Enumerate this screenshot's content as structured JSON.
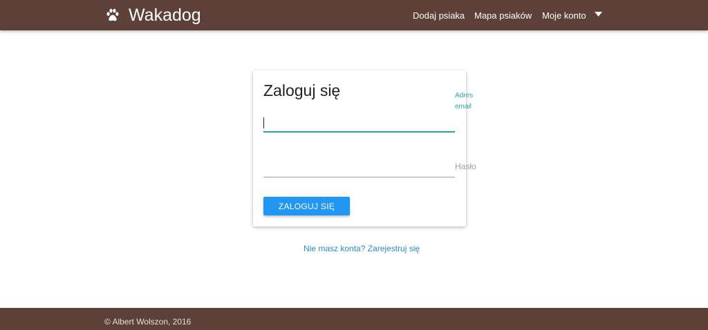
{
  "header": {
    "brand": "Wakadog",
    "brand_icon": "paw-icon",
    "nav": [
      {
        "label": "Dodaj psiaka"
      },
      {
        "label": "Mapa psiaków"
      },
      {
        "label": "Moje konto"
      }
    ],
    "dropdown_icon": "caret-down-icon",
    "background_color": "#5d4037"
  },
  "login": {
    "title": "Zaloguj się",
    "email_label": "Adres email",
    "email_value": "",
    "password_label": "Hasło",
    "password_value": "",
    "submit_label": "ZALOGUJ SIĘ",
    "accent_color": "#26a69a",
    "button_color": "#2196f3"
  },
  "register_link": "Nie masz konta? Zarejestruj się",
  "footer": {
    "copyright": "© Albert Wolszon, 2016"
  }
}
